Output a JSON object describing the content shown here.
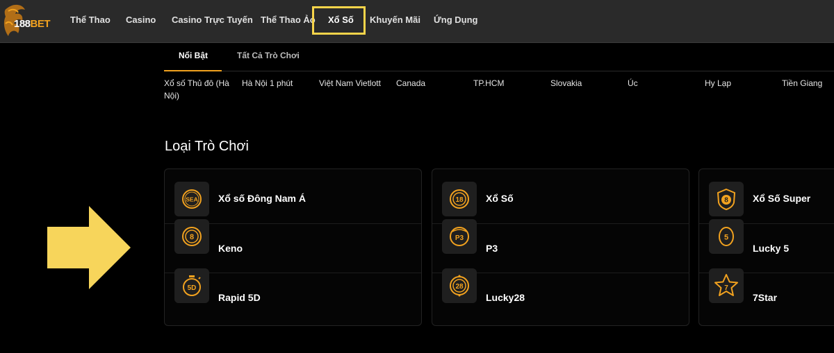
{
  "brand": {
    "number": "188",
    "suffix": "BET",
    "accent": "#f2a21f"
  },
  "nav": {
    "items": [
      "Thể Thao",
      "Casino",
      "Casino Trực Tuyến",
      "Thể Thao Ảo",
      "Xổ Số",
      "Khuyến Mãi",
      "Ứng Dụng"
    ],
    "active": "Xổ Số",
    "highlight_color": "#f7d44a"
  },
  "tabs": {
    "items": [
      "Nổi Bật",
      "Tất Cả Trò Chơi"
    ],
    "active": "Nổi Bật"
  },
  "provinces": [
    "Xổ số Thủ đô (Hà Nội)",
    "Hà Nội 1 phút",
    "Việt Nam Vietlott",
    "Canada",
    "TP.HCM",
    "Slovakia",
    "Úc",
    "Hy Lạp",
    "Tiền Giang"
  ],
  "section": {
    "title": "Loại Trò Chơi"
  },
  "game_columns": [
    [
      {
        "label": "Xổ số Đông Nam Á",
        "icon": "sea-lottery-icon"
      },
      {
        "label": "Keno",
        "icon": "keno-8-ball-icon"
      },
      {
        "label": "Rapid 5D",
        "icon": "rapid-5d-stopwatch-icon"
      }
    ],
    [
      {
        "label": "Xổ Số",
        "icon": "lottery-18-ball-icon"
      },
      {
        "label": "P3",
        "icon": "p3-ball-icon"
      },
      {
        "label": "Lucky28",
        "icon": "lucky28-ball-icon"
      }
    ],
    [
      {
        "label": "Xổ Số Super",
        "icon": "super-8-shield-icon"
      },
      {
        "label": "Lucky 5",
        "icon": "lucky5-coin-icon"
      },
      {
        "label": "7Star",
        "icon": "seven-star-icon"
      }
    ]
  ],
  "colors": {
    "icon_orange": "#f2a21f",
    "arrow_yellow": "#f7d55b",
    "background": "#000000",
    "topbar": "#2a2a2a"
  }
}
